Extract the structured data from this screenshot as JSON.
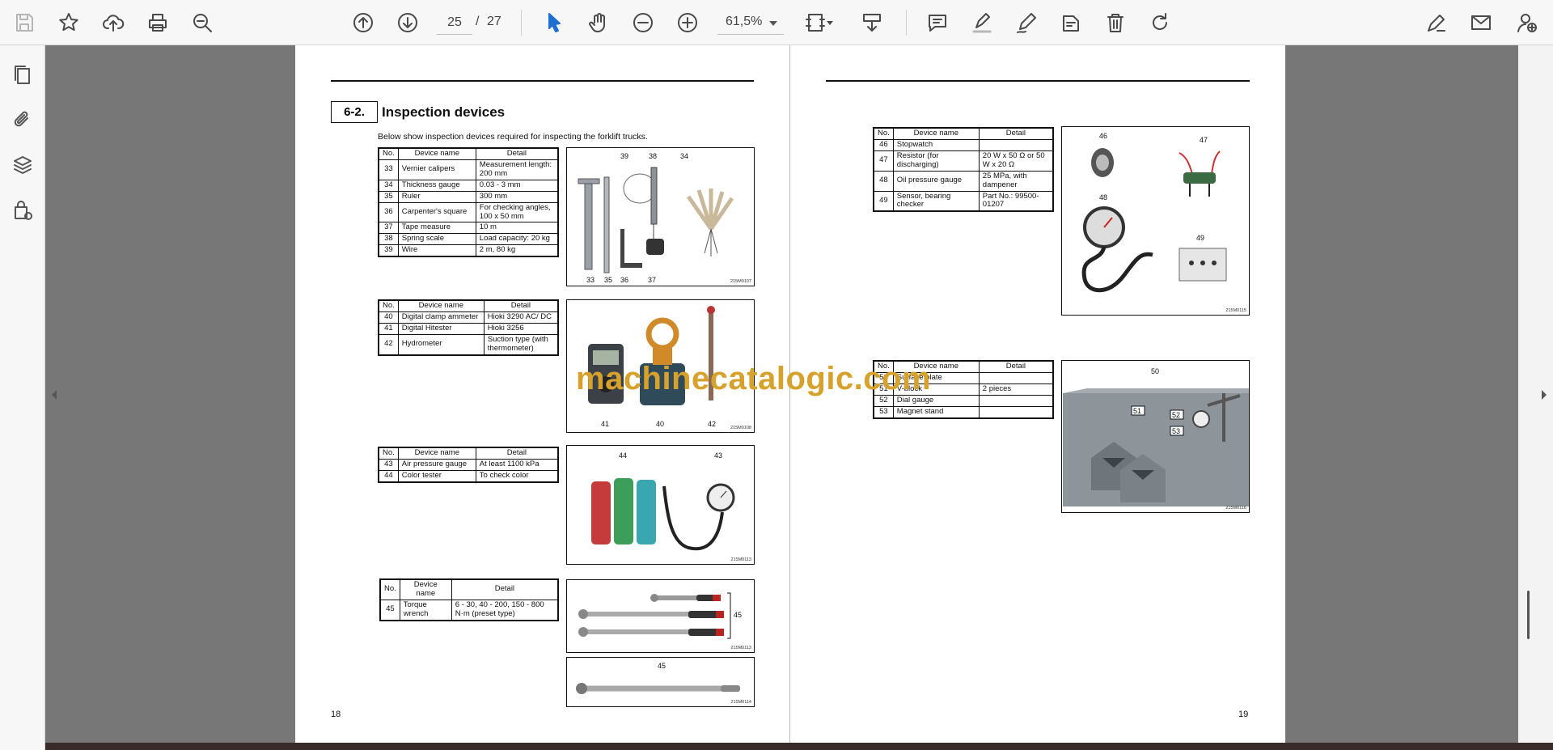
{
  "toolbar": {
    "page_current": "25",
    "page_separator": "/",
    "page_total": "27",
    "zoom": "61,5%",
    "icons": [
      "save-icon",
      "bookmark-star-icon",
      "cloud-upload-icon",
      "print-icon",
      "zoom-search-icon",
      "page-up-icon",
      "page-down-icon",
      "select-cursor-icon",
      "hand-tool-icon",
      "zoom-out-icon",
      "zoom-in-icon",
      "fit-page-icon",
      "page-extract-icon",
      "comment-icon",
      "highlight-icon",
      "pen-icon",
      "stamp-icon",
      "delete-icon",
      "redo-icon",
      "sign-icon",
      "email-icon",
      "add-user-icon"
    ]
  },
  "sidebar": {
    "icons": [
      "pages-icon",
      "attachment-icon",
      "layers-icon",
      "security-icon"
    ]
  },
  "left_page": {
    "section_number": "6-2.",
    "section_title": "Inspection devices",
    "intro": "Below show inspection devices required for inspecting the forklift trucks.",
    "page_number": "18",
    "headers": {
      "no": "No.",
      "name": "Device name",
      "detail": "Detail"
    },
    "table1": [
      {
        "no": "33",
        "name": "Vernier calipers",
        "detail": "Measurement length: 200 mm"
      },
      {
        "no": "34",
        "name": "Thickness gauge",
        "detail": "0.03 - 3 mm"
      },
      {
        "no": "35",
        "name": "Ruler",
        "detail": "300 mm"
      },
      {
        "no": "36",
        "name": "Carpenter's square",
        "detail": "For checking angles, 100 x 50 mm"
      },
      {
        "no": "37",
        "name": "Tape measure",
        "detail": "10 m"
      },
      {
        "no": "38",
        "name": "Spring scale",
        "detail": "Load capacity: 20 kg"
      },
      {
        "no": "39",
        "name": "Wire",
        "detail": "2 m, 80 kg"
      }
    ],
    "table2": [
      {
        "no": "40",
        "name": "Digital clamp ammeter",
        "detail": "Hioki 3290 AC/ DC"
      },
      {
        "no": "41",
        "name": "Digital Hitester",
        "detail": "Hioki 3256"
      },
      {
        "no": "42",
        "name": "Hydrometer",
        "detail": "Suction type (with thermometer)"
      }
    ],
    "table3": [
      {
        "no": "43",
        "name": "Air pressure gauge",
        "detail": "At least 1100 kPa"
      },
      {
        "no": "44",
        "name": "Color tester",
        "detail": "To check color"
      }
    ],
    "table4": [
      {
        "no": "45",
        "name": "Torque wrench",
        "detail": "6 - 30, 40 - 200, 150 - 800 N·m (preset type)"
      }
    ],
    "fig1": {
      "labels_top": [
        "39",
        "38",
        "34"
      ],
      "labels_bottom": [
        "33",
        "35",
        "36",
        "37"
      ],
      "code": "215M0107"
    },
    "fig2": {
      "labels": [
        "41",
        "40",
        "42"
      ],
      "code": "215M0108"
    },
    "fig3": {
      "labels": [
        "44",
        "43"
      ],
      "code": "215M0113"
    },
    "fig4": {
      "labels": [
        "45"
      ],
      "code": "215M0113"
    },
    "fig5": {
      "labels": [
        "45"
      ],
      "code": "215M0114"
    }
  },
  "right_page": {
    "page_number": "19",
    "table5": [
      {
        "no": "46",
        "name": "Stopwatch",
        "detail": ""
      },
      {
        "no": "47",
        "name": "Resistor (for discharging)",
        "detail": "20 W x 50 Ω or 50 W x 20 Ω"
      },
      {
        "no": "48",
        "name": "Oil pressure gauge",
        "detail": "25 MPa, with dampener"
      },
      {
        "no": "49",
        "name": "Sensor, bearing checker",
        "detail": "Part No.: 99500-01207"
      }
    ],
    "table6": [
      {
        "no": "50",
        "name": "Surface plate",
        "detail": ""
      },
      {
        "no": "51",
        "name": "V-block",
        "detail": "2 pieces"
      },
      {
        "no": "52",
        "name": "Dial gauge",
        "detail": ""
      },
      {
        "no": "53",
        "name": "Magnet stand",
        "detail": ""
      }
    ],
    "fig6": {
      "labels": [
        "46",
        "47",
        "48",
        "49"
      ],
      "code": "215M0115"
    },
    "fig7": {
      "labels": [
        "50",
        "51",
        "52",
        "53"
      ],
      "code": "215M0116"
    }
  },
  "watermark": "machinecatalogic.com",
  "colors": {
    "watermark": "#d7a22b",
    "active_tool": "#1f6fd1",
    "viewport": "#777777"
  }
}
